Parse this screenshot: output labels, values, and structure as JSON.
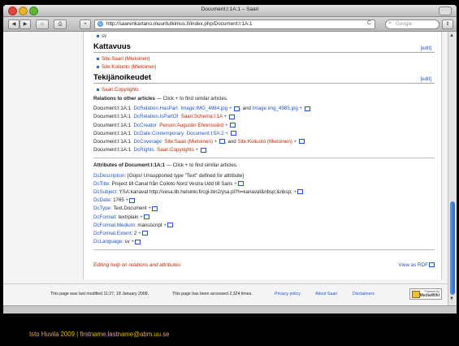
{
  "window": {
    "title": "Document:I:1A:1 – Saari"
  },
  "toolbar": {
    "back": "◀",
    "forward": "▶",
    "home": "⌂",
    "print": "⎙",
    "add": "+",
    "url": "http://saarenkartano.muuritutkimus.fi/index.php/Document:I:1A:1",
    "reload": "C",
    "search_placeholder": "Google"
  },
  "top_item": "sv",
  "sections": [
    {
      "heading": "Kattavuus",
      "edit": "[edit]",
      "items": [
        "Site:Saari (Mietoinen)",
        "Site:Koiluoto (Mietoinen)"
      ]
    },
    {
      "heading": "Tekijänoikeudet",
      "edit": "[edit]",
      "items": [
        "Saari:Copyrights"
      ]
    }
  ],
  "relations": {
    "heading": "Relations to other articles",
    "hint": " — Click + to find similar articles.",
    "rows": [
      {
        "subject": "Document:I:1A:1",
        "prop": "DcRelation.HasPart",
        "parts": [
          "Image:IMG_4984.jpg",
          " + ",
          ", and ",
          "Image:img_4985.jpg",
          " + "
        ]
      },
      {
        "subject": "Document:I:1A:1",
        "prop": "DcRelation.IsPartOf",
        "parts": [
          "Saari:Schema:I:1A",
          " + "
        ]
      },
      {
        "subject": "Document:I:1A:1",
        "prop": "DcCreator",
        "parts": [
          "Person:Augustin Ehrensvärd",
          " + "
        ]
      },
      {
        "subject": "Document:I:1A:1",
        "prop": "DcDate.Contemporary",
        "parts": [
          "Document:I:5A:2",
          " + "
        ]
      },
      {
        "subject": "Document:I:1A:1",
        "prop": "DcCoverage",
        "parts": [
          "Site:Saari (Mietoinen)",
          " + ",
          ", and ",
          "Site:Koiluoto (Mietoinen)",
          " + "
        ]
      },
      {
        "subject": "Document:I:1A:1",
        "prop": "DcRights",
        "parts": [
          "Saari:Copyrights",
          " + "
        ]
      }
    ]
  },
  "attributes": {
    "heading": "Attributes of Document:I:1A:1",
    "hint": " — Click + to find similar articles.",
    "rows": [
      {
        "key": "DcDescription",
        "val": "[Oops! Unsupported type \"Text\" defined for attribute]",
        "plus": ""
      },
      {
        "key": "DcTitle",
        "val": "Project till Canal från Coiloto Nord Vestra Udd till Saris",
        "plus": "+"
      },
      {
        "key": "DcSubject",
        "val": "YSA:kanavat http://vesa.lib.helsinki.fi/cgi-bin2/ysa.pl?h=kanavat&nbsp;&nbsp;",
        "plus": "+"
      },
      {
        "key": "DcDate",
        "val": "1765",
        "plus": "+"
      },
      {
        "key": "DcType",
        "val": "Text.Document",
        "plus": "+"
      },
      {
        "key": "DcFormat",
        "val": "text/plain",
        "plus": "+"
      },
      {
        "key": "DcFormat.Medium",
        "val": "manuscript",
        "plus": "+"
      },
      {
        "key": "DcFormat.Extent",
        "val": "2",
        "plus": "+"
      },
      {
        "key": "DcLanguage",
        "val": "sv",
        "plus": "+"
      }
    ]
  },
  "help_link": "Editing help on relations and attributes",
  "rdf_link": "View as RDF",
  "footer": {
    "modified": "This page was last modified 11:27, 18 January 2008.",
    "accessed": "This page has been accessed 2,324 times.",
    "privacy": "Privacy policy",
    "about": "About Saari",
    "disclaimers": "Disclaimers",
    "mw_powered": "Powered by",
    "mw_name": "MediaWiki"
  },
  "caption": "Isto Huvila 2009 | firstname.lastname@abm.uu.se"
}
